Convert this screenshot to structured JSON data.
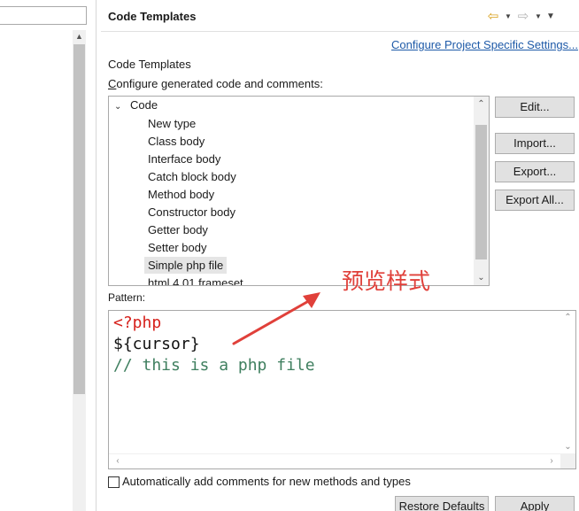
{
  "header": {
    "title": "Code Templates",
    "configure_link": "Configure Project Specific Settings..."
  },
  "section": {
    "title": "Code Templates",
    "description": "Configure generated code and comments:"
  },
  "tree": {
    "root_label": "Code",
    "items": [
      {
        "label": "New type"
      },
      {
        "label": "Class body"
      },
      {
        "label": "Interface body"
      },
      {
        "label": "Catch block body"
      },
      {
        "label": "Method body"
      },
      {
        "label": "Constructor body"
      },
      {
        "label": "Getter body"
      },
      {
        "label": "Setter body"
      },
      {
        "label": "Simple php file",
        "selected": true
      },
      {
        "label": "html 4.01 frameset"
      }
    ]
  },
  "buttons": {
    "edit": "Edit...",
    "import": "Import...",
    "export": "Export...",
    "export_all": "Export All...",
    "restore_defaults": "Restore Defaults",
    "apply": "Apply"
  },
  "pattern": {
    "label": "Pattern:",
    "lines": [
      "<?php",
      "${cursor}",
      "// this is a php file"
    ]
  },
  "options": {
    "auto_comments_label": "Automatically add comments for new methods and types",
    "auto_comments_checked": false
  },
  "annotation": {
    "text": "预览样式",
    "color": "#e0403a"
  },
  "icons": {
    "back": "back-arrow-icon",
    "forward": "forward-arrow-icon",
    "menu": "view-menu-icon"
  },
  "colors": {
    "link": "#1e5aa8",
    "code_keyword": "#d6201b",
    "code_comment": "#3f7f5f"
  }
}
